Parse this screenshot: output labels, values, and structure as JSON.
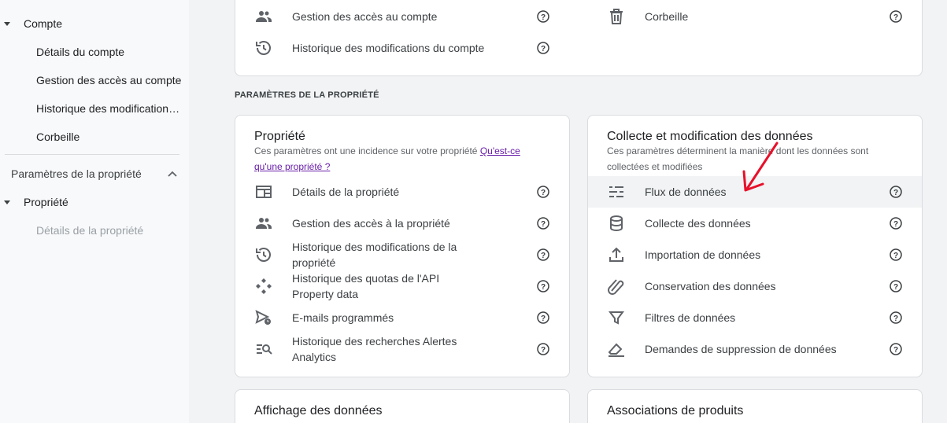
{
  "sidebar": {
    "account_label": "Compte",
    "account_items": [
      "Détails du compte",
      "Gestion des accès au compte",
      "Historique des modifications du compte",
      "Corbeille"
    ],
    "property_settings_label": "Paramètres de la propriété",
    "property_label": "Propriété",
    "property_items": [
      "Détails de la propriété"
    ]
  },
  "account_card": {
    "left_rows": [
      {
        "label": "Gestion des accès au compte",
        "icon": "people-icon"
      },
      {
        "label": "Historique des modifications du compte",
        "icon": "history-icon"
      }
    ],
    "right_rows": [
      {
        "label": "Corbeille",
        "icon": "trash-icon"
      }
    ]
  },
  "section_heading": "PARAMÈTRES DE LA PROPRIÉTÉ",
  "property_card": {
    "title": "Propriété",
    "desc_text": "Ces paramètres ont une incidence sur votre propriété ",
    "desc_link": "Qu'est-ce qu'une propriété ?",
    "rows": [
      {
        "label": "Détails de la propriété",
        "icon": "property-details-icon"
      },
      {
        "label": "Gestion des accès à la propriété",
        "icon": "people-icon"
      },
      {
        "label": "Historique des modifications de la propriété",
        "icon": "history-icon"
      },
      {
        "label": "Historique des quotas de l'API Property data",
        "icon": "api-icon"
      },
      {
        "label": "E-mails programmés",
        "icon": "scheduled-email-icon"
      },
      {
        "label": "Historique des recherches Alertes Analytics",
        "icon": "search-history-icon"
      }
    ]
  },
  "data_card": {
    "title": "Collecte et modification des données",
    "desc": "Ces paramètres déterminent la manière dont les données sont collectées et modifiées",
    "rows": [
      {
        "label": "Flux de données",
        "icon": "data-streams-icon",
        "active": true
      },
      {
        "label": "Collecte des données",
        "icon": "database-icon"
      },
      {
        "label": "Importation de données",
        "icon": "upload-icon"
      },
      {
        "label": "Conservation des données",
        "icon": "retention-icon"
      },
      {
        "label": "Filtres de données",
        "icon": "filter-icon"
      },
      {
        "label": "Demandes de suppression de données",
        "icon": "eraser-icon"
      }
    ]
  },
  "display_card": {
    "title": "Affichage des données"
  },
  "products_card": {
    "title": "Associations de produits"
  },
  "colors": {
    "link": "#681da8",
    "annotation_arrow": "#e8102a"
  }
}
